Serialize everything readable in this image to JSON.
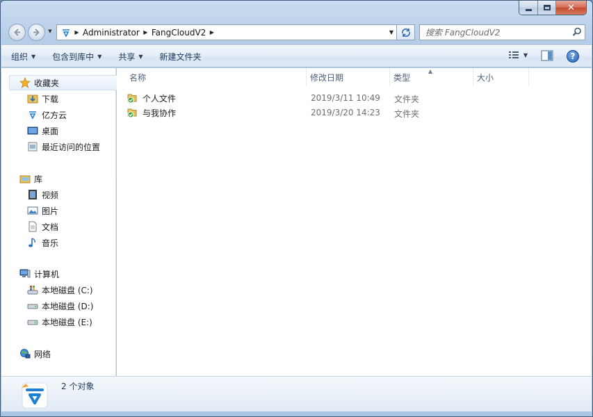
{
  "window": {
    "minimize_label": "",
    "maximize_label": "",
    "close_label": "✕"
  },
  "address": {
    "crumbs": [
      "Administrator",
      "FangCloudV2"
    ]
  },
  "search": {
    "placeholder": "搜索 FangCloudV2"
  },
  "toolbar": {
    "organize": "组织",
    "include_in_library": "包含到库中",
    "share": "共享",
    "new_folder": "新建文件夹"
  },
  "nav": {
    "favorites": "收藏夹",
    "downloads": "下载",
    "yifangyun": "亿方云",
    "desktop": "桌面",
    "recent_places": "最近访问的位置",
    "libraries": "库",
    "videos": "视频",
    "pictures": "图片",
    "documents": "文档",
    "music": "音乐",
    "computer": "计算机",
    "drive_c": "本地磁盘 (C:)",
    "drive_d": "本地磁盘 (D:)",
    "drive_e": "本地磁盘 (E:)",
    "network": "网络"
  },
  "columns": {
    "name": "名称",
    "date_modified": "修改日期",
    "type": "类型",
    "size": "大小"
  },
  "files": [
    {
      "name": "个人文件",
      "date": "2019/3/11 10:49",
      "type": "文件夹"
    },
    {
      "name": "与我协作",
      "date": "2019/3/20 14:23",
      "type": "文件夹"
    }
  ],
  "status": {
    "item_count": "2 个对象"
  },
  "colors": {
    "accent": "#1e395b",
    "folder": "#e8c25a",
    "sync_check": "#33a036",
    "app_blue": "#1d7fd6"
  }
}
